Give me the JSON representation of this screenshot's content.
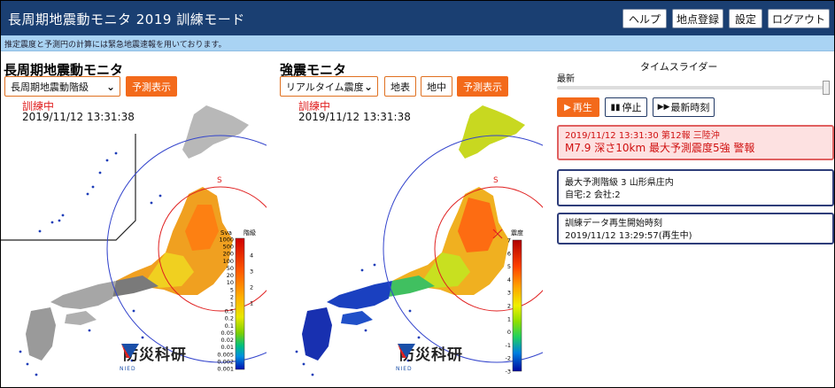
{
  "app": {
    "title": "長周期地震動モニタ 2019 訓練モード"
  },
  "topnav": {
    "help": "ヘルプ",
    "register_point": "地点登録",
    "settings": "設定",
    "logout": "ログアウト"
  },
  "notice": "推定震度と予測円の計算には緊急地震速報を用いております。",
  "left_panel": {
    "title": "長周期地震動モニタ",
    "select_value": "長周期地震動階級",
    "predict_button": "予測表示",
    "status": "訓練中",
    "timestamp": "2019/11/12 13:31:38",
    "legend_title_sva": "Sva",
    "legend_title_class": "階級",
    "sva_ticks": [
      "1000",
      "500",
      "200",
      "100",
      "50",
      "20",
      "10",
      "5",
      "2",
      "1",
      "0.5",
      "0.2",
      "0.1",
      "0.05",
      "0.02",
      "0.01",
      "0.005",
      "0.002",
      "0.001"
    ],
    "class_ticks": [
      "4",
      "3",
      "2",
      "1"
    ],
    "circle_label": "S",
    "brand": "防災科研",
    "brand_sub": "NIED"
  },
  "right_panel": {
    "title": "強震モニタ",
    "select_value": "リアルタイム震度",
    "btn_surface": "地表",
    "btn_underground": "地中",
    "predict_button": "予測表示",
    "status": "訓練中",
    "timestamp": "2019/11/12 13:31:38",
    "legend_title": "震度",
    "ticks": [
      "7",
      "6",
      "5",
      "4",
      "3",
      "2",
      "1",
      "0",
      "-1",
      "-2",
      "-3"
    ],
    "circle_label": "S",
    "brand": "防災科研",
    "brand_sub": "NIED"
  },
  "time_slider": {
    "title": "タイムスライダー",
    "latest_label": "最新",
    "play": "再生",
    "stop": "停止",
    "latest_time": "最新時刻",
    "play_icon": "play-icon",
    "stop_icon": "pause-icon",
    "latest_icon": "fast-forward-icon"
  },
  "alert_box": {
    "line1": "2019/11/12 13:31:30 第12報 三陸沖",
    "line2": "M7.9 深さ10km 最大予測震度5強 警報"
  },
  "info_box1": {
    "line1": "最大予測階級 3 山形県庄内",
    "line2": "自宅:2 会社:2"
  },
  "info_box2": {
    "line1": "訓練データ再生開始時刻",
    "line2": "2019/11/12 13:29:57(再生中)"
  },
  "colors": {
    "header": "#1a3f72",
    "notice_bar": "#a9d3f3",
    "accent": "#f36a1b",
    "alert_text": "#d01010",
    "info_border": "#2e3d7a"
  }
}
